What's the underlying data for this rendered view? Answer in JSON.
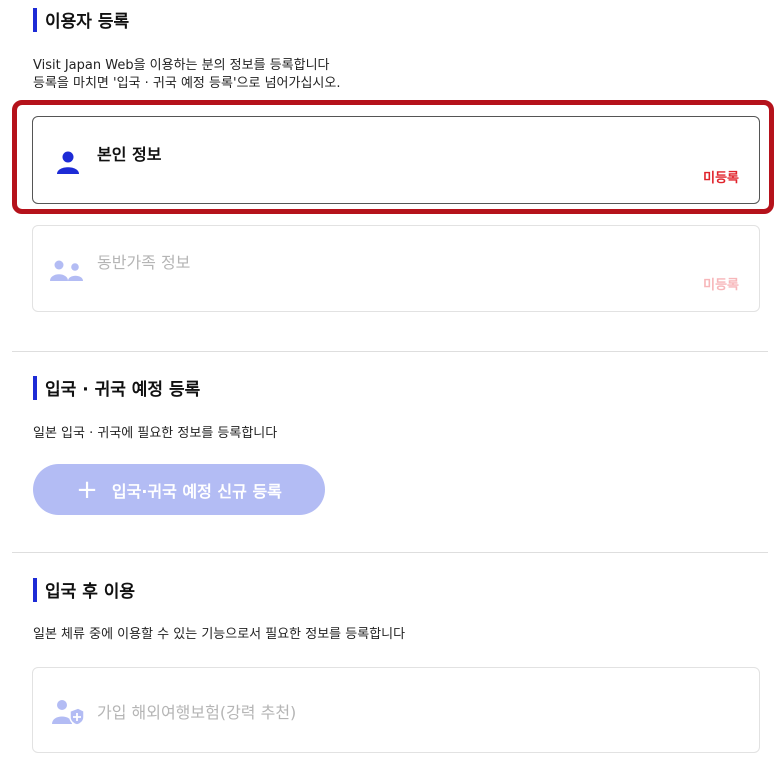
{
  "user_registration": {
    "title": "이용자 등록",
    "desc_line1": "Visit Japan Web을 이용하는 분의 정보를 등록합니다",
    "desc_line2": "등록을 마치면 '입국 · 귀국 예정 등록'으로 넘어가십시오.",
    "self_card": {
      "label": "본인 정보",
      "status": "미등록",
      "icon": "person-icon"
    },
    "family_card": {
      "label": "동반가족 정보",
      "status": "미등록",
      "icon": "group-icon"
    }
  },
  "entry_plan": {
    "title": "입국 · 귀국 예정 등록",
    "desc": "일본 입국 · 귀국에 필요한 정보를 등록합니다",
    "new_button": {
      "icon": "plus-icon",
      "label": "입국·귀국 예정 신규 등록"
    }
  },
  "after_entry": {
    "title": "입국 후 이용",
    "desc": "일본 체류 중에 이용할 수 있는 기능으로서 필요한 정보를 등록합니다",
    "insurance_card": {
      "label": "가입 해외여행보험(강력 추천)",
      "icon": "person-shield-icon"
    }
  },
  "colors": {
    "accent": "#1d2bd6",
    "status_red": "#e0232b",
    "highlight": "#b5121b",
    "button_disabled": "#b3bcf4"
  }
}
